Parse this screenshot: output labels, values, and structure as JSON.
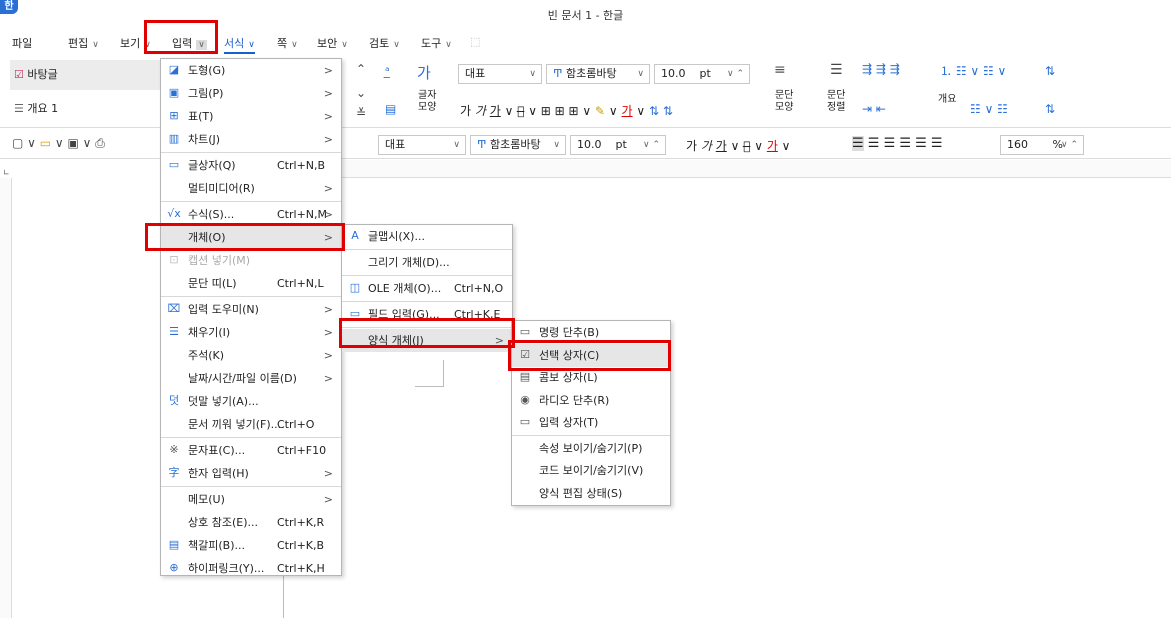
{
  "window": {
    "title": "빈 문서 1 - 한글",
    "logo": "한"
  },
  "menubar": {
    "items": [
      {
        "label": "파일",
        "chev": ""
      },
      {
        "label": "편집",
        "chev": "∨"
      },
      {
        "label": "보기",
        "chev": "∨"
      },
      {
        "label": "입력",
        "chev": "∨"
      },
      {
        "label": "서식",
        "chev": "∨"
      },
      {
        "label": "쪽",
        "chev": "∨"
      },
      {
        "label": "보안",
        "chev": "∨"
      },
      {
        "label": "검토",
        "chev": "∨"
      },
      {
        "label": "도구",
        "chev": "∨"
      }
    ]
  },
  "style_panel": {
    "items": [
      "바탕글",
      "개요 1"
    ]
  },
  "ribbon": {
    "font_style": "대표",
    "font_name": "함초롬바탕",
    "font_size": "10.0",
    "font_unit": "pt",
    "char_shape_label": "글자\n모양",
    "para_shape_label": "문단\n모양",
    "para_align_label": "문단\n정렬",
    "outline_label": "개요",
    "font_style2": "대표",
    "font_name2": "함초롬바탕",
    "font_size2": "10.0",
    "font_unit2": "pt",
    "zoom": "160",
    "zoom_unit": "%"
  },
  "input_menu": {
    "items": [
      {
        "label": "도형(G)",
        "shortcut": "",
        "arrow": ">",
        "icon": "shape-icon"
      },
      {
        "label": "그림(P)",
        "shortcut": "",
        "arrow": ">",
        "icon": "picture-icon"
      },
      {
        "label": "표(T)",
        "shortcut": "",
        "arrow": ">",
        "icon": "table-icon"
      },
      {
        "label": "차트(J)",
        "shortcut": "",
        "arrow": ">",
        "icon": "chart-icon"
      },
      {
        "label": "글상자(Q)",
        "shortcut": "Ctrl+N,B",
        "arrow": "",
        "icon": "textbox-icon"
      },
      {
        "label": "멀티미디어(R)",
        "shortcut": "",
        "arrow": ">",
        "icon": ""
      },
      {
        "label": "수식(S)...",
        "shortcut": "Ctrl+N,M",
        "arrow": ">",
        "icon": "formula-icon"
      },
      {
        "label": "개체(O)",
        "shortcut": "",
        "arrow": ">",
        "icon": ""
      },
      {
        "label": "캡션 넣기(M)",
        "shortcut": "",
        "arrow": "",
        "icon": "caption-icon"
      },
      {
        "label": "문단 띠(L)",
        "shortcut": "Ctrl+N,L",
        "arrow": "",
        "icon": ""
      },
      {
        "label": "입력 도우미(N)",
        "shortcut": "",
        "arrow": ">",
        "icon": "input-helper-icon"
      },
      {
        "label": "채우기(I)",
        "shortcut": "",
        "arrow": ">",
        "icon": "fill-icon"
      },
      {
        "label": "주석(K)",
        "shortcut": "",
        "arrow": ">",
        "icon": ""
      },
      {
        "label": "날짜/시간/파일 이름(D)",
        "shortcut": "",
        "arrow": ">",
        "icon": ""
      },
      {
        "label": "덧말 넣기(A)...",
        "shortcut": "",
        "arrow": "",
        "icon": "ruby-icon"
      },
      {
        "label": "문서 끼워 넣기(F)...",
        "shortcut": "Ctrl+O",
        "arrow": "",
        "icon": ""
      },
      {
        "label": "문자표(C)...",
        "shortcut": "Ctrl+F10",
        "arrow": "",
        "icon": "symbol-icon"
      },
      {
        "label": "한자 입력(H)",
        "shortcut": "",
        "arrow": ">",
        "icon": "hanja-icon"
      },
      {
        "label": "메모(U)",
        "shortcut": "",
        "arrow": ">",
        "icon": ""
      },
      {
        "label": "상호 참조(E)...",
        "shortcut": "Ctrl+K,R",
        "arrow": "",
        "icon": ""
      },
      {
        "label": "책갈피(B)...",
        "shortcut": "Ctrl+K,B",
        "arrow": "",
        "icon": "bookmark-icon"
      },
      {
        "label": "하이퍼링크(Y)...",
        "shortcut": "Ctrl+K,H",
        "arrow": "",
        "icon": "hyperlink-icon"
      }
    ]
  },
  "object_menu": {
    "items": [
      {
        "label": "글맵시(X)...",
        "shortcut": "",
        "arrow": "",
        "icon": "textart-icon"
      },
      {
        "label": "그리기 개체(D)...",
        "shortcut": "",
        "arrow": "",
        "icon": ""
      },
      {
        "label": "OLE 개체(O)...",
        "shortcut": "Ctrl+N,O",
        "arrow": "",
        "icon": "ole-icon"
      },
      {
        "label": "필드 입력(G)...",
        "shortcut": "Ctrl+K,E",
        "arrow": "",
        "icon": "field-icon"
      },
      {
        "label": "양식 개체(J)",
        "shortcut": "",
        "arrow": ">",
        "icon": ""
      }
    ]
  },
  "form_menu": {
    "items": [
      {
        "label": "명령 단추(B)",
        "icon": "button-icon"
      },
      {
        "label": "선택 상자(C)",
        "icon": "checkbox-icon"
      },
      {
        "label": "콤보 상자(L)",
        "icon": "combobox-icon"
      },
      {
        "label": "라디오 단추(R)",
        "icon": "radio-icon"
      },
      {
        "label": "입력 상자(T)",
        "icon": "inputbox-icon"
      },
      {
        "label": "속성 보이기/숨기기(P)",
        "icon": ""
      },
      {
        "label": "코드 보이기/숨기기(V)",
        "icon": ""
      },
      {
        "label": "양식 편집 상태(S)",
        "icon": ""
      }
    ]
  },
  "colors": {
    "highlight_red": "#e00000",
    "accent_blue": "#1a5fd0"
  }
}
